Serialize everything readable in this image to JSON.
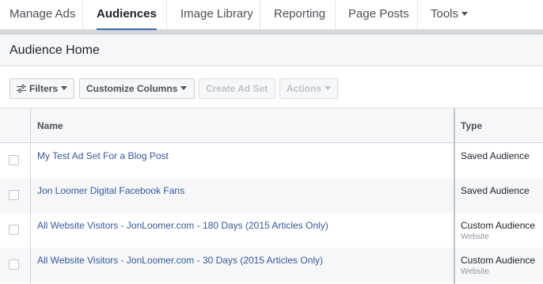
{
  "nav": {
    "items": [
      {
        "label": "Manage Ads",
        "active": false
      },
      {
        "label": "Audiences",
        "active": true
      },
      {
        "label": "Image Library",
        "active": false
      },
      {
        "label": "Reporting",
        "active": false
      },
      {
        "label": "Page Posts",
        "active": false
      },
      {
        "label": "Tools",
        "active": false,
        "has_dropdown": true
      }
    ]
  },
  "panel": {
    "title": "Audience Home"
  },
  "toolbar": {
    "filters_label": "Filters",
    "customize_columns_label": "Customize Columns",
    "create_ad_set_label": "Create Ad Set",
    "actions_label": "Actions"
  },
  "table": {
    "columns": {
      "name": "Name",
      "type": "Type"
    },
    "rows": [
      {
        "name": "My Test Ad Set For a Blog Post",
        "type": "Saved Audience",
        "subtype": ""
      },
      {
        "name": "Jon Loomer Digital Facebook Fans",
        "type": "Saved Audience",
        "subtype": ""
      },
      {
        "name": "All Website Visitors - JonLoomer.com - 180 Days (2015 Articles Only)",
        "type": "Custom Audience",
        "subtype": "Website"
      },
      {
        "name": "All Website Visitors - JonLoomer.com - 30 Days (2015 Articles Only)",
        "type": "Custom Audience",
        "subtype": "Website"
      }
    ]
  },
  "colors": {
    "accent": "#4267b2",
    "link": "#365899"
  },
  "icons": {
    "filters": "filter-sliders-icon",
    "dropdown": "caret-down-icon"
  }
}
